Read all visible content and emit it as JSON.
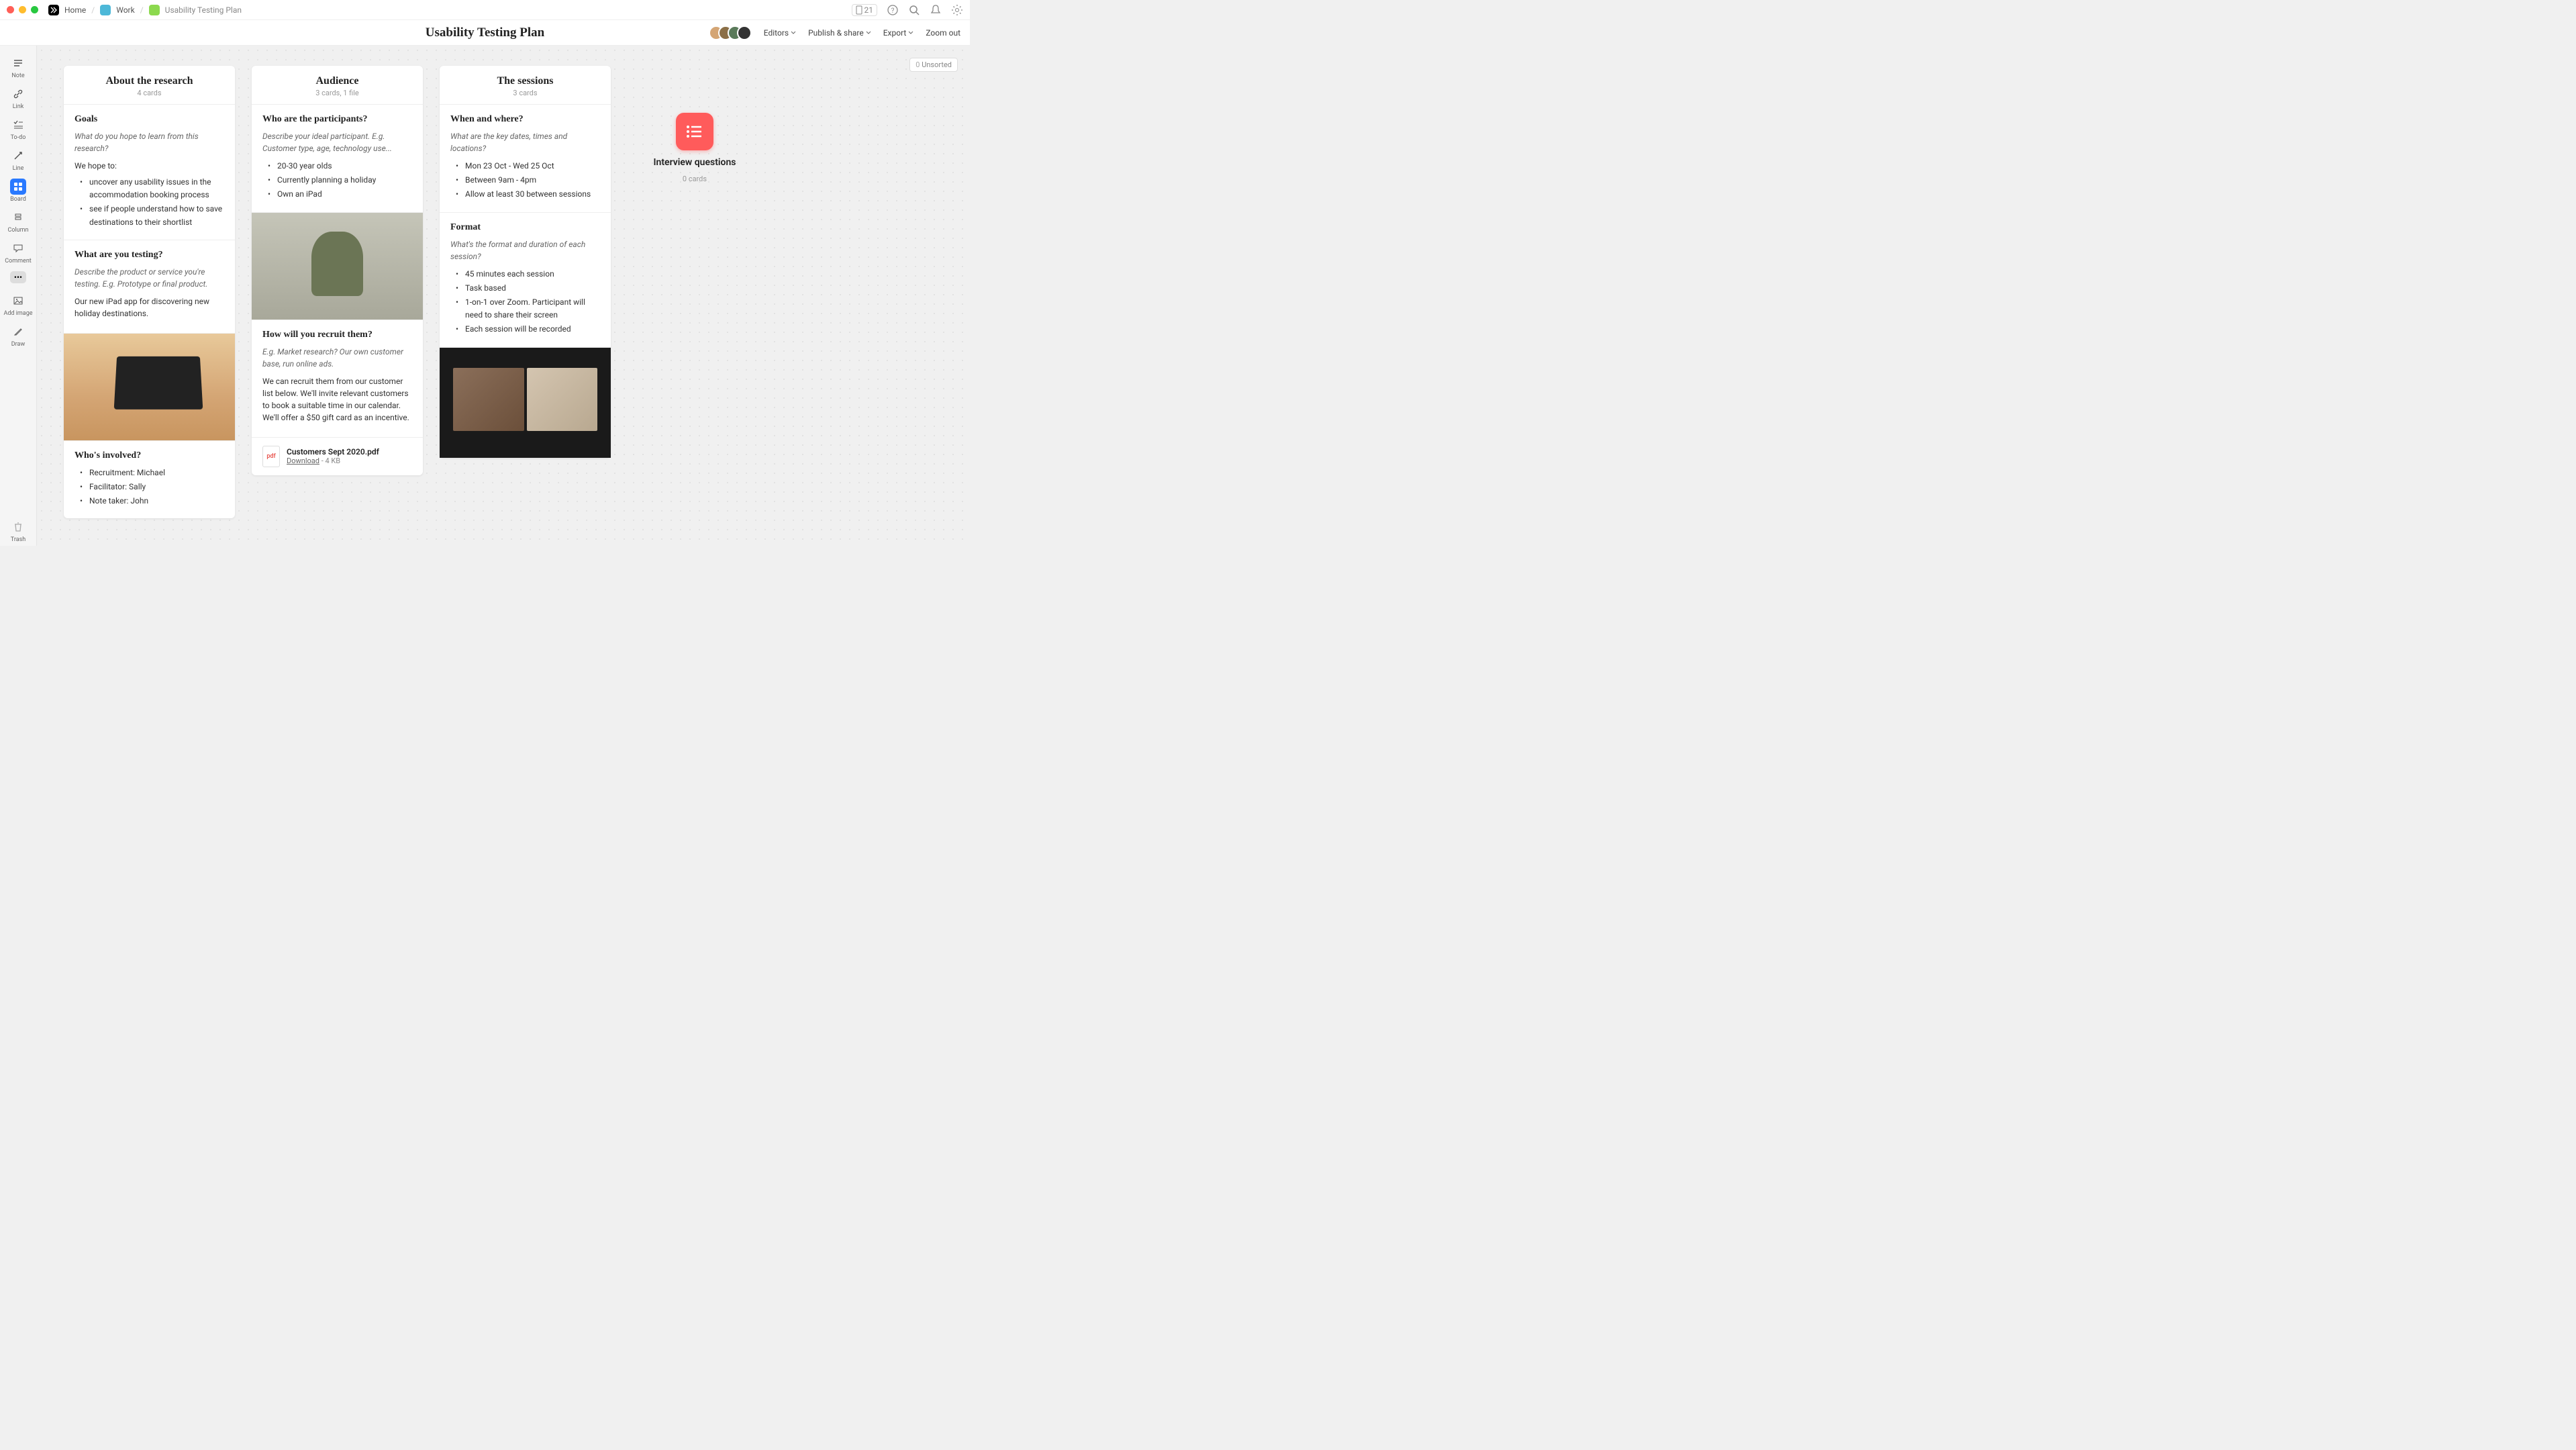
{
  "breadcrumb": {
    "home": "Home",
    "work": "Work",
    "doc": "Usability Testing Plan"
  },
  "topbar": {
    "device_count": "21"
  },
  "header": {
    "title": "Usability Testing Plan",
    "editors": "Editors",
    "publish": "Publish & share",
    "export": "Export",
    "zoom": "Zoom out"
  },
  "sidebar": {
    "note": "Note",
    "link": "Link",
    "todo": "To-do",
    "line": "Line",
    "board": "Board",
    "column": "Column",
    "comment": "Comment",
    "addimage": "Add image",
    "draw": "Draw",
    "trash": "Trash"
  },
  "unsorted": {
    "count": "0",
    "label": "Unsorted"
  },
  "columns": [
    {
      "title": "About the research",
      "sub": "4 cards",
      "cards": [
        {
          "h": "Goals",
          "prompt": "What do you hope to learn from this research?",
          "text": "We hope to:",
          "bullets": [
            "uncover any usability issues in the accommodation booking process",
            "see if people understand how to save destinations to their shortlist"
          ]
        },
        {
          "h": "What are you testing?",
          "prompt": "Describe the product or service you're testing. E.g. Prototype or final product.",
          "text": "Our new iPad app for discovering new holiday destinations."
        },
        {
          "image": "ipad"
        },
        {
          "h": "Who's involved?",
          "bullets": [
            "Recruitment: Michael",
            "Facilitator: Sally",
            "Note taker: John"
          ]
        }
      ]
    },
    {
      "title": "Audience",
      "sub": "3 cards, 1 file",
      "cards": [
        {
          "h": "Who are the participants?",
          "prompt": "Describe your ideal participant. E.g. Customer type, age, technology use...",
          "bullets": [
            "20-30 year olds",
            "Currently planning a holiday",
            "Own an iPad"
          ]
        },
        {
          "image": "person"
        },
        {
          "h": "How will you recruit them?",
          "prompt": "E.g. Market research? Our own customer base, run online ads.",
          "text": "We can recruit them from our customer list below. We'll invite relevant customers to book a suitable time in our calendar. We'll offer a $50 gift card as an incentive."
        },
        {
          "file": {
            "name": "Customers Sept 2020.pdf",
            "download": "Download",
            "size": "4 KB"
          }
        }
      ]
    },
    {
      "title": "The sessions",
      "sub": "3 cards",
      "cards": [
        {
          "h": "When and where?",
          "prompt": "What are the key dates, times and locations?",
          "bullets": [
            "Mon 23 Oct - Wed 25 Oct",
            "Between 9am - 4pm",
            "Allow at least 30 between sessions"
          ]
        },
        {
          "h": "Format",
          "prompt": "What's the format and duration of each session?",
          "bullets": [
            "45 minutes each session",
            "Task based",
            "1-on-1 over Zoom. Participant will need to share their screen",
            "Each session will be recorded"
          ]
        },
        {
          "image": "zoom"
        }
      ]
    }
  ],
  "stack": {
    "title": "Interview questions",
    "sub": "0 cards"
  }
}
